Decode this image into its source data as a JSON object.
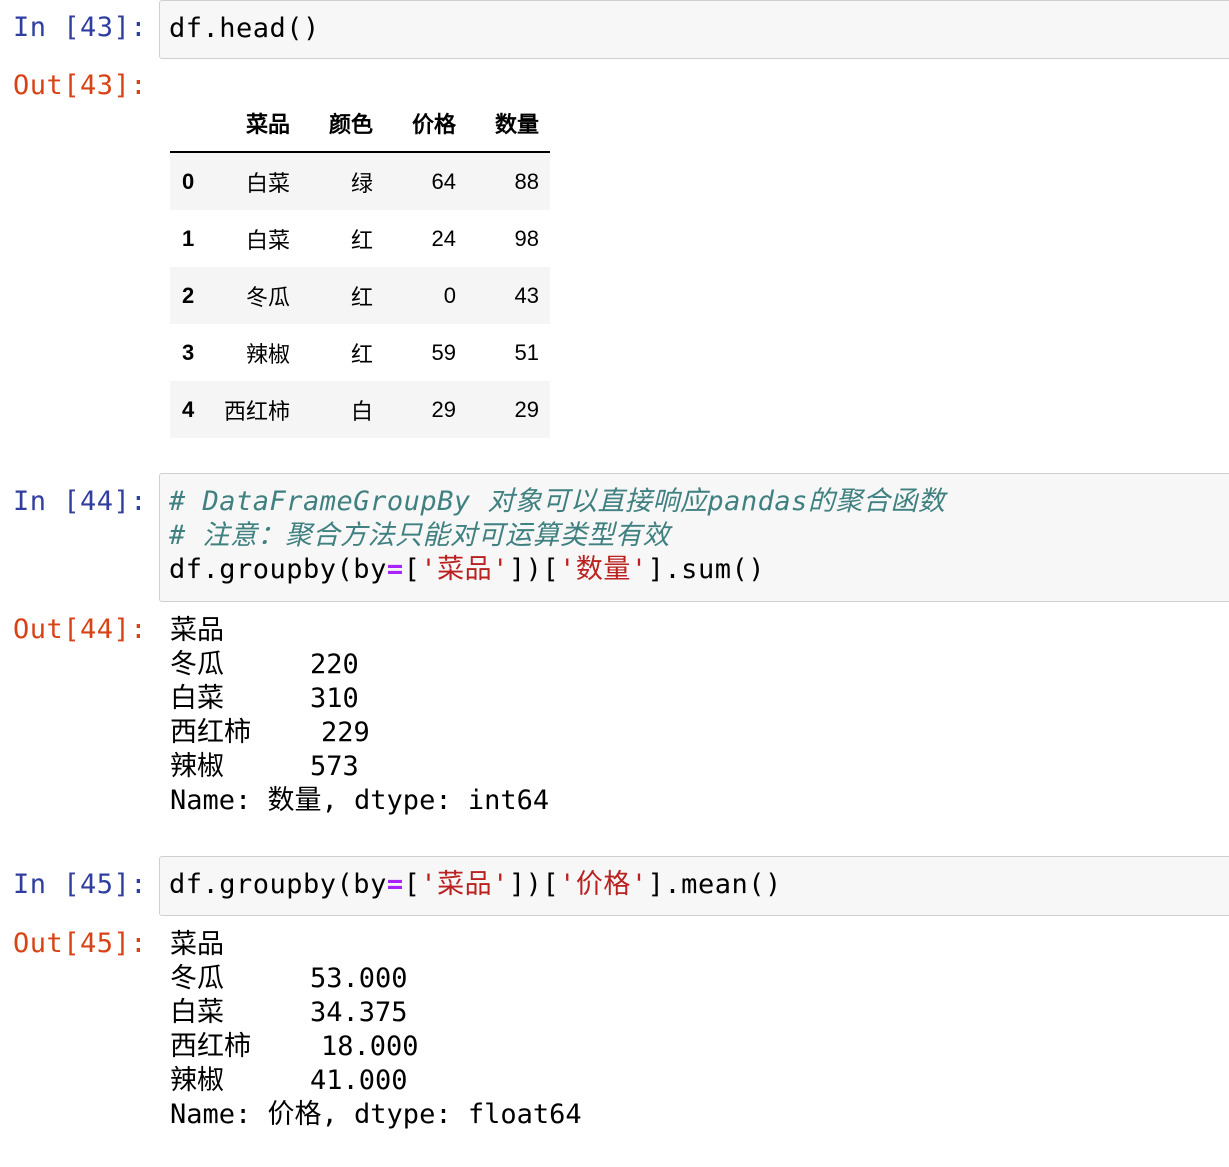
{
  "cells": [
    {
      "in_prompt": "In [43]:",
      "code": [
        "df.head()"
      ],
      "out_prompt": "Out[43]:",
      "table": {
        "columns": [
          "菜品",
          "颜色",
          "价格",
          "数量"
        ],
        "rows": [
          {
            "index": "0",
            "values": [
              "白菜",
              "绿",
              "64",
              "88"
            ]
          },
          {
            "index": "1",
            "values": [
              "白菜",
              "红",
              "24",
              "98"
            ]
          },
          {
            "index": "2",
            "values": [
              "冬瓜",
              "红",
              "0",
              "43"
            ]
          },
          {
            "index": "3",
            "values": [
              "辣椒",
              "红",
              "59",
              "51"
            ]
          },
          {
            "index": "4",
            "values": [
              "西红柿",
              "白",
              "29",
              "29"
            ]
          }
        ]
      }
    },
    {
      "in_prompt": "In [44]:",
      "comment_1": "# DataFrameGroupBy 对象可以直接响应pandas的聚合函数",
      "comment_2": "# 注意：聚合方法只能对可运算类型有效",
      "code_prefix": "df.groupby(by",
      "code_eq": "=",
      "code_bracket_1": "[",
      "code_str_1": "'菜品'",
      "code_mid": "])[",
      "code_str_2": "'数量'",
      "code_suffix": "].sum()",
      "out_prompt": "Out[44]:",
      "series": {
        "index_name": "菜品",
        "items": [
          {
            "label": "冬瓜",
            "value": "220"
          },
          {
            "label": "白菜",
            "value": "310"
          },
          {
            "label": "西红柿",
            "value": "229"
          },
          {
            "label": "辣椒",
            "value": "573"
          }
        ],
        "footer": "Name: 数量, dtype: int64"
      }
    },
    {
      "in_prompt": "In [45]:",
      "code_prefix": "df.groupby(by",
      "code_eq": "=",
      "code_bracket_1": "[",
      "code_str_1": "'菜品'",
      "code_mid": "])[",
      "code_str_2": "'价格'",
      "code_suffix": "].mean()",
      "out_prompt": "Out[45]:",
      "series": {
        "index_name": "菜品",
        "items": [
          {
            "label": "冬瓜",
            "value": "53.000"
          },
          {
            "label": "白菜",
            "value": "34.375"
          },
          {
            "label": "西红柿",
            "value": "18.000"
          },
          {
            "label": "辣椒",
            "value": "41.000"
          }
        ],
        "footer": "Name: 价格, dtype: float64"
      }
    }
  ]
}
